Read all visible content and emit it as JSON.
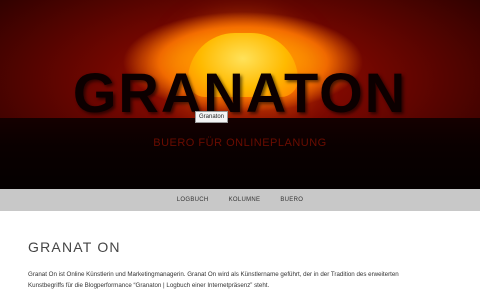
{
  "header": {
    "title": "GRANATON",
    "tooltip": "Granaton",
    "subtitle": "BUERO FÜR ONLINEPLANUNG"
  },
  "nav": {
    "items": [
      {
        "label": "LOGBUCH"
      },
      {
        "label": "KOLUMNE"
      },
      {
        "label": "BUERO"
      }
    ]
  },
  "main": {
    "title": "GRANAT ON",
    "paragraph_line1": "Granat On ist Online Künstlerin und Marketingmanagerin. Granat On wird als Künstlername geführt, der in der Tradition des erweiterten",
    "paragraph_line2": "Kunstbegriffs für die Blogperformance “Granaton | Logbuch einer Internetpräsenz” steht."
  }
}
